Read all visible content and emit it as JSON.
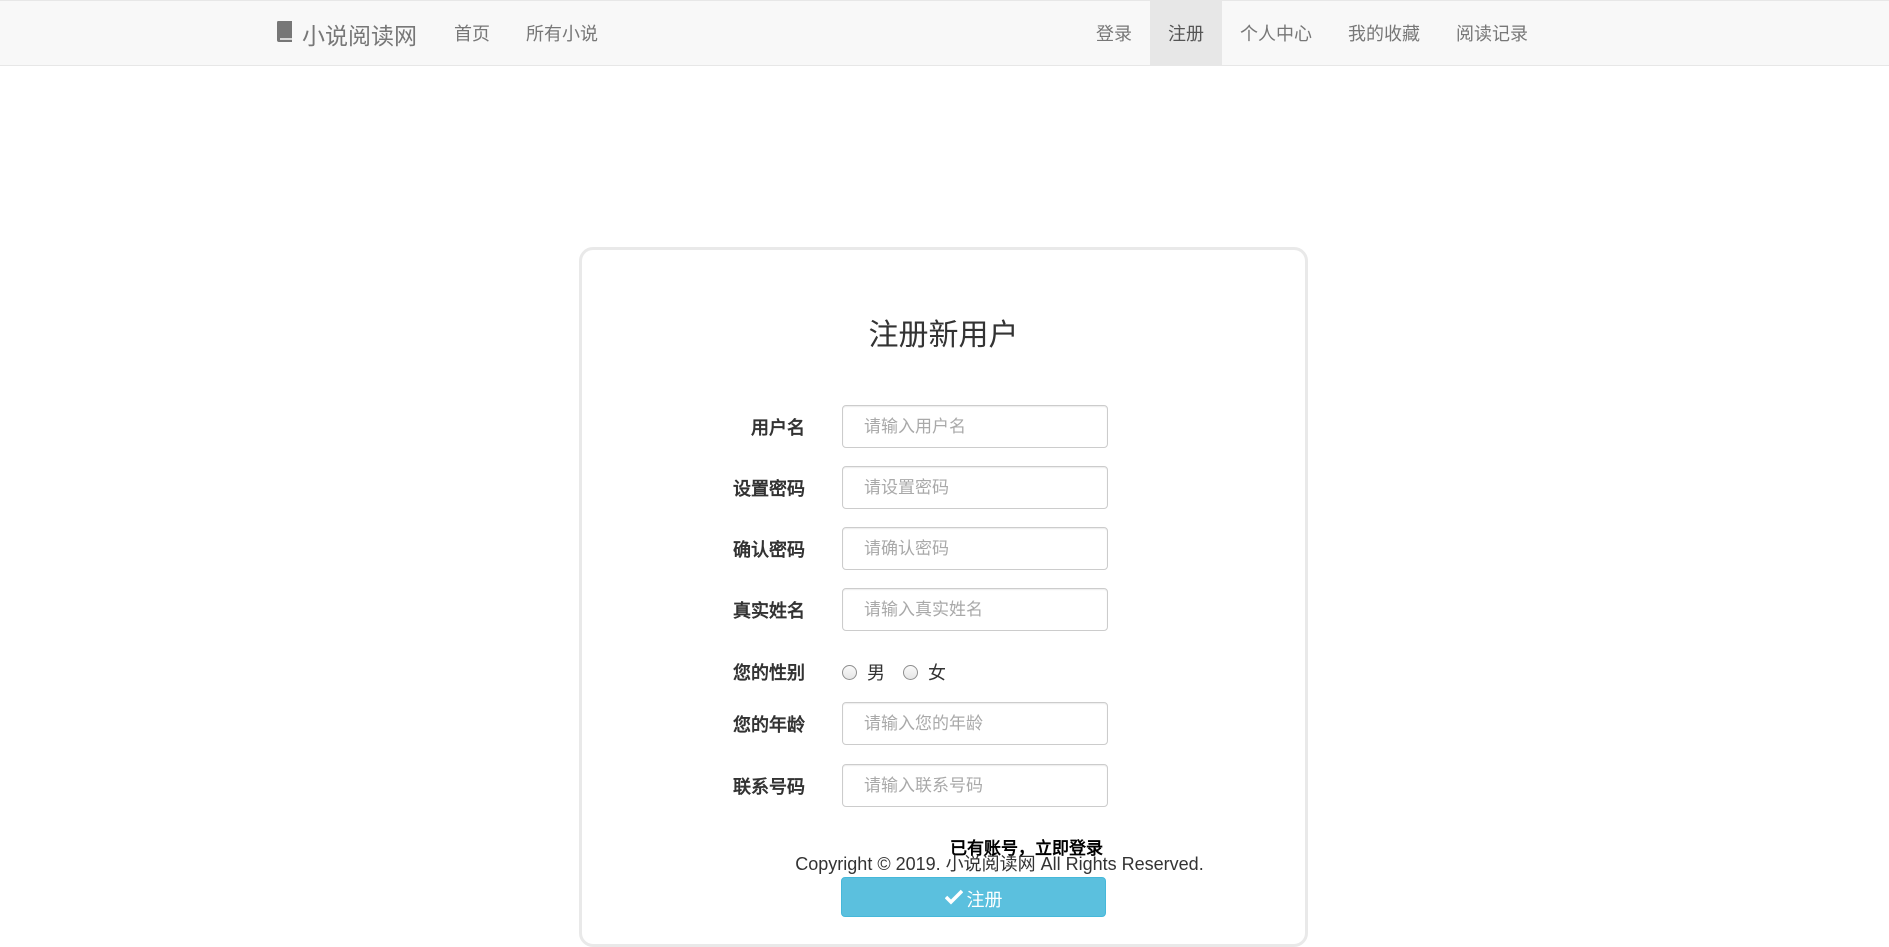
{
  "navbar": {
    "brand": "小说阅读网",
    "brand_icon": "book-icon",
    "left_items": [
      "首页",
      "所有小说"
    ],
    "right_items": [
      "登录",
      "注册",
      "个人中心",
      "我的收藏",
      "阅读记录"
    ],
    "active_item": "注册"
  },
  "form": {
    "title": "注册新用户",
    "username": {
      "label": "用户名",
      "placeholder": "请输入用户名"
    },
    "password": {
      "label": "设置密码",
      "placeholder": "请设置密码"
    },
    "confirm_password": {
      "label": "确认密码",
      "placeholder": "请确认密码"
    },
    "real_name": {
      "label": "真实姓名",
      "placeholder": "请输入真实姓名"
    },
    "gender": {
      "label": "您的性别",
      "options": [
        "男",
        "女"
      ]
    },
    "age": {
      "label": "您的年龄",
      "placeholder": "请输入您的年龄"
    },
    "phone": {
      "label": "联系号码",
      "placeholder": "请输入联系号码"
    },
    "login_link": "已有账号，立即登录",
    "submit_label": "注册",
    "submit_icon": "check-icon"
  },
  "footer": {
    "copyright": "Copyright © 2019. 小说阅读网 All Rights Reserved."
  },
  "colors": {
    "navbar_bg": "#f8f8f8",
    "active_nav_bg": "#e7e7e7",
    "submit_bg": "#5bc0de"
  }
}
